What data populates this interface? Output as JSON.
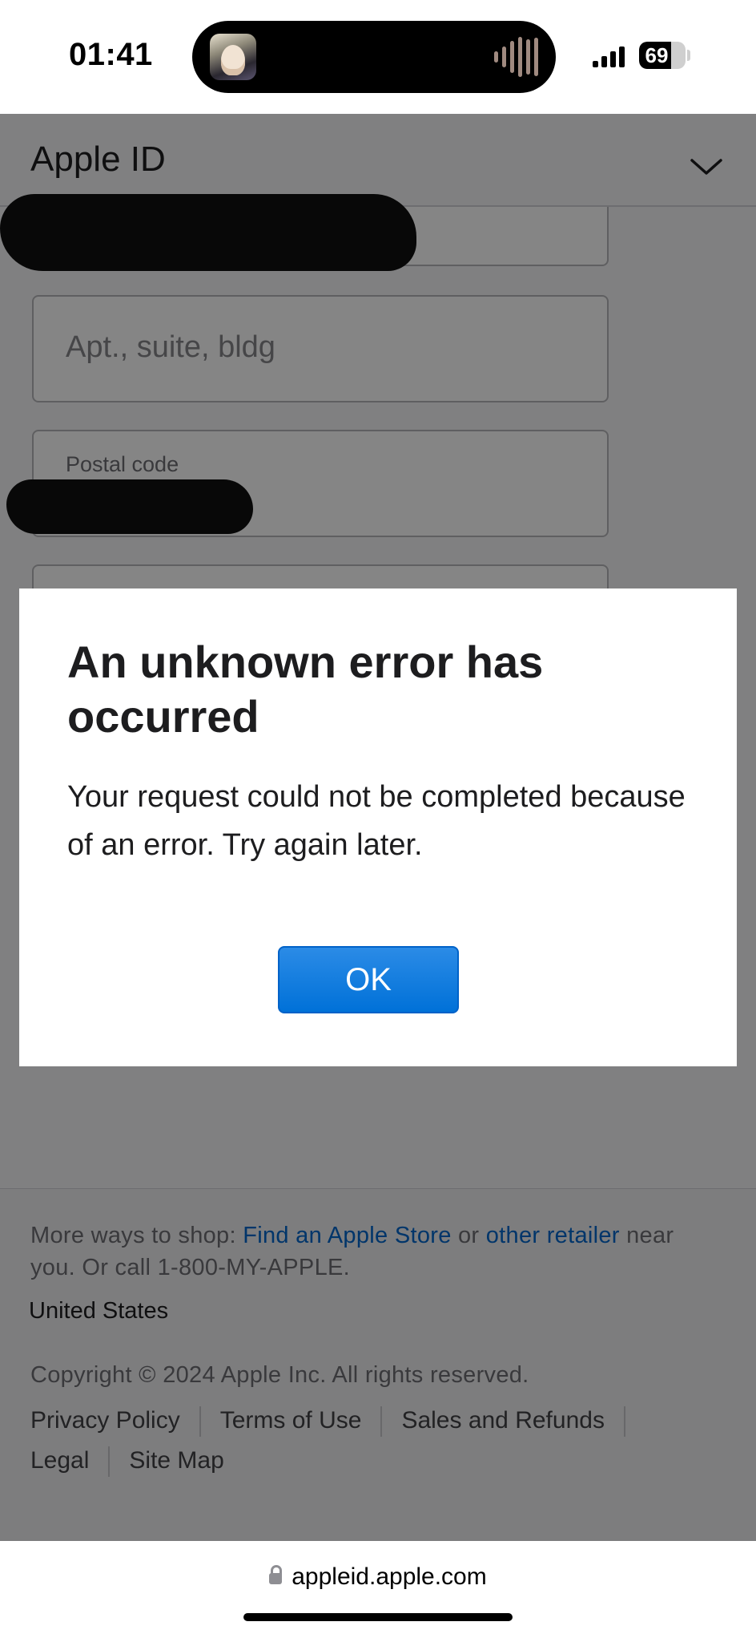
{
  "status_bar": {
    "time": "01:41",
    "battery": "69",
    "battery_level": 0.69
  },
  "header": {
    "title": "Apple ID"
  },
  "form": {
    "apt_placeholder": "Apt., suite, bldg",
    "postal_label": "Postal code"
  },
  "dialog": {
    "title": "An unknown error has occurred",
    "message": "Your request could not be completed because of an error. Try again later.",
    "ok_label": "OK"
  },
  "footer": {
    "ways_prefix": "More ways to shop: ",
    "store_link": "Find an Apple Store",
    "or_text": " or ",
    "retailer_link": "other retailer",
    "ways_suffix": " near you. Or call 1-800-MY-APPLE.",
    "country": "United States",
    "copyright": "Copyright © 2024 Apple Inc. All rights reserved.",
    "links": [
      "Privacy Policy",
      "Terms of Use",
      "Sales and Refunds",
      "Legal",
      "Site Map"
    ]
  },
  "browser": {
    "url": "appleid.apple.com"
  },
  "colors": {
    "accent": "#0071e3",
    "link": "#0066cc"
  }
}
